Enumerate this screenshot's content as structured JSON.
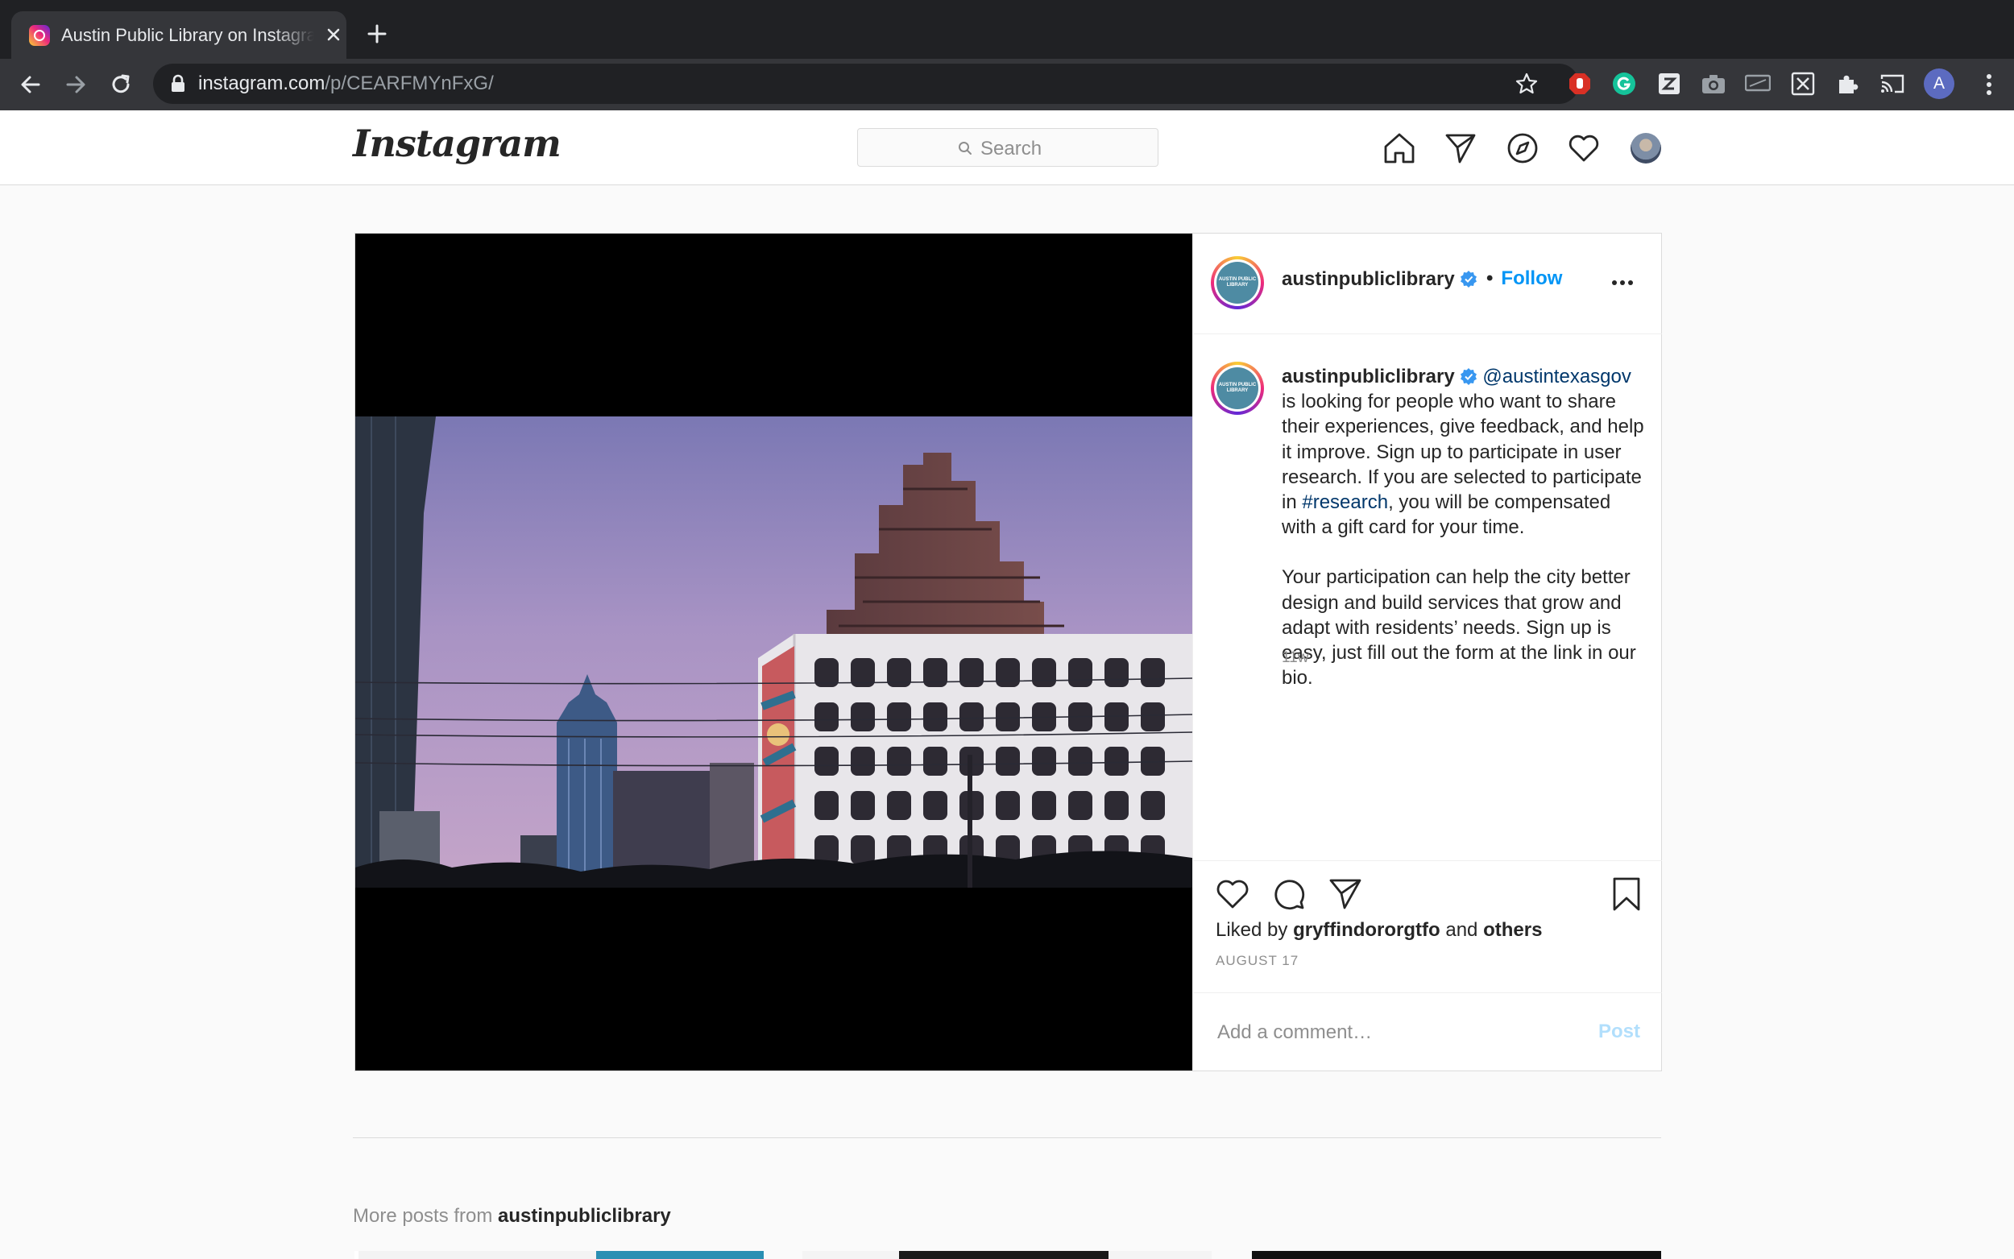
{
  "browser": {
    "tab_title": "Austin Public Library on Instagram",
    "url_host": "instagram.com",
    "url_path": "/p/CEARFMYnFxG/",
    "profile_initial": "A"
  },
  "nav": {
    "logo": "Instagram",
    "search_placeholder": "Search"
  },
  "post": {
    "username": "austinpubliclibrary",
    "follow_label": "Follow",
    "avatar_text": "AUSTIN PUBLIC LIBRARY",
    "caption": {
      "mention": "@austintexasgov",
      "text1": " is looking for people who want to share their experiences, give feedback, and help it improve. Sign up to participate in user research. If you are selected to participate in ",
      "hashtag": "#research",
      "text2": ", you will be compensated with a gift card for your time.",
      "paragraph2": "Your participation can help the city better design and build services that grow and adapt with residents’ needs. Sign up is easy, just fill out the form at the link in our bio."
    },
    "time_ago": "11w",
    "liked_prefix": "Liked by ",
    "liked_user": "gryffindororgtfo",
    "liked_and": " and ",
    "liked_others": "others",
    "date": "AUGUST 17",
    "comment_placeholder": "Add a comment…",
    "post_label": "Post"
  },
  "more_posts": {
    "prefix": "More posts from ",
    "user": "austinpubliclibrary"
  },
  "colors": {
    "link_blue": "#0095f6",
    "hashtag_blue": "#00376b",
    "chrome_dark": "#202124"
  }
}
